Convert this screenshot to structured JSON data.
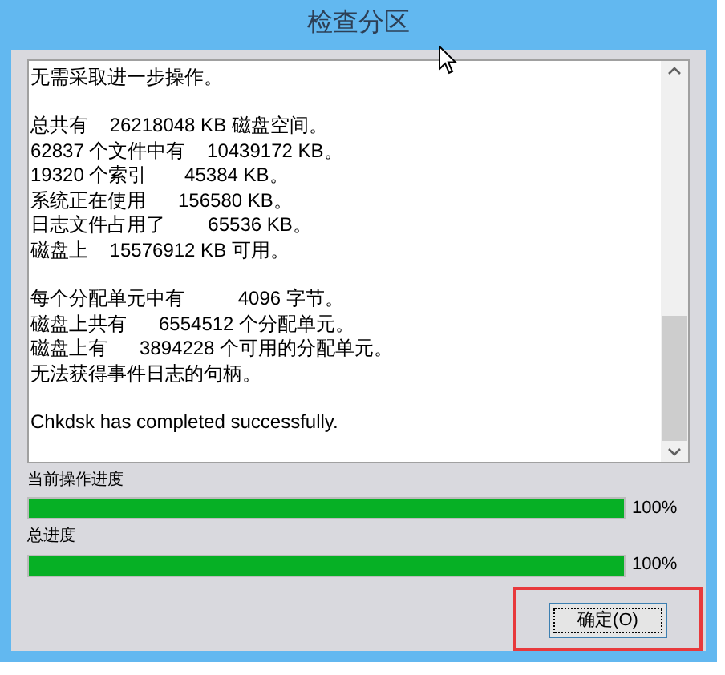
{
  "window": {
    "title": "检查分区"
  },
  "log": [
    {
      "lines": [
        "无需采取进一步操作。"
      ]
    },
    {
      "lines": [
        "总共有    26218048 KB 磁盘空间。",
        "62837 个文件中有    10439172 KB。",
        "19320 个索引       45384 KB。",
        "系统正在使用      156580 KB。",
        "日志文件占用了        65536 KB。",
        "磁盘上    15576912 KB 可用。"
      ]
    },
    {
      "lines": [
        "每个分配单元中有          4096 字节。",
        "磁盘上共有      6554512 个分配单元。",
        "磁盘上有      3894228 个可用的分配单元。",
        "无法获得事件日志的句柄。"
      ]
    },
    {
      "lines": [
        "Chkdsk has completed successfully."
      ]
    }
  ],
  "progress": [
    {
      "label": "当前操作进度",
      "level": 1,
      "reading": "100%"
    },
    {
      "label": "总进度",
      "level": 1,
      "reading": "100%"
    }
  ],
  "ok_button": {
    "label": "确定(O)",
    "highlighted": true
  }
}
